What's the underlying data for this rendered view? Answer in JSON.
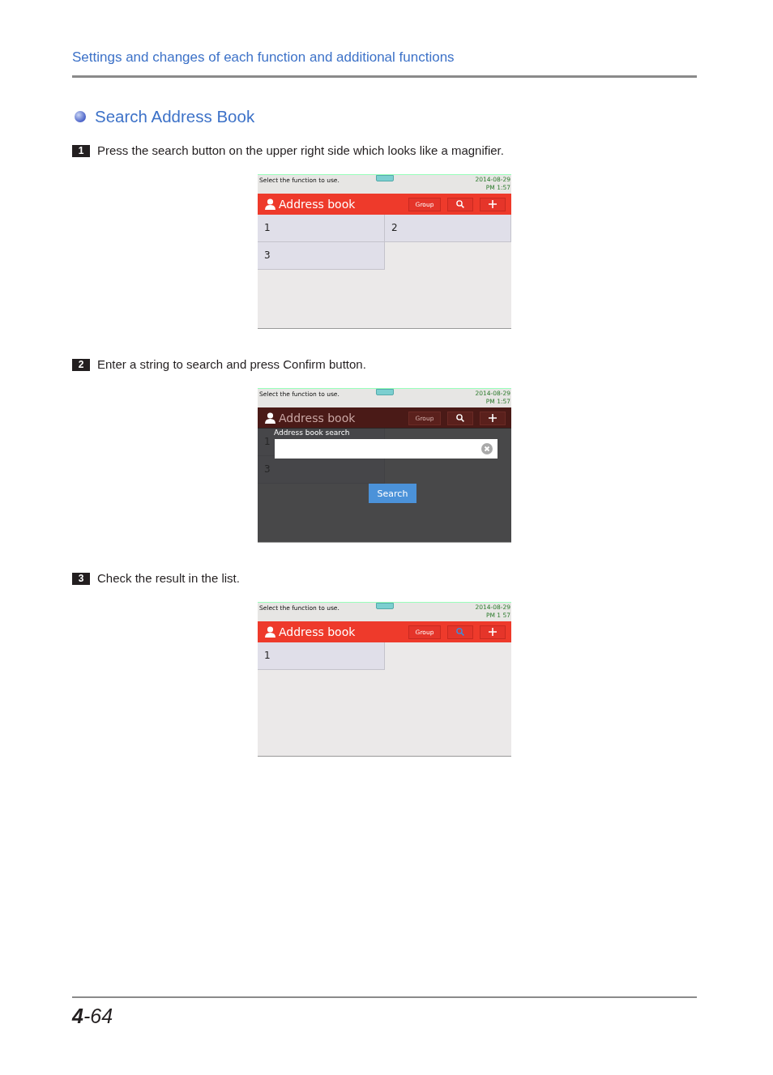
{
  "header": {
    "title": "Settings and changes of each function and additional functions"
  },
  "section": {
    "title": "Search Address Book"
  },
  "steps": [
    {
      "number": "1",
      "text": "Press the search button on the upper right side which looks like a magnifier.",
      "screen": {
        "status_text": "Select the function to use.",
        "date": "2014-08-29",
        "time": "PM 1:57",
        "app_title": "Address book",
        "group_button": "Group",
        "search_active": false,
        "rows": [
          [
            "1",
            "2"
          ],
          [
            "3"
          ]
        ]
      }
    },
    {
      "number": "2",
      "text": "Enter a string to search and press Confirm button.",
      "screen": {
        "status_text": "Select the function to use.",
        "date": "2014-08-29",
        "time": "PM 1:57",
        "app_title": "Address book",
        "group_button": "Group",
        "search_active": false,
        "rows": [
          [
            "1"
          ],
          [
            "3"
          ]
        ],
        "dialog": {
          "title": "Address book search",
          "button": "Search"
        }
      }
    },
    {
      "number": "3",
      "text": "Check the result in the list.",
      "screen": {
        "status_text": "Select the function to use.",
        "date": "2014-08-29",
        "time": "PM 1  57",
        "app_title": "Address book",
        "group_button": "Group",
        "search_active": true,
        "rows": [
          [
            "1"
          ]
        ]
      }
    }
  ],
  "footer": {
    "page": "**4**-64"
  }
}
